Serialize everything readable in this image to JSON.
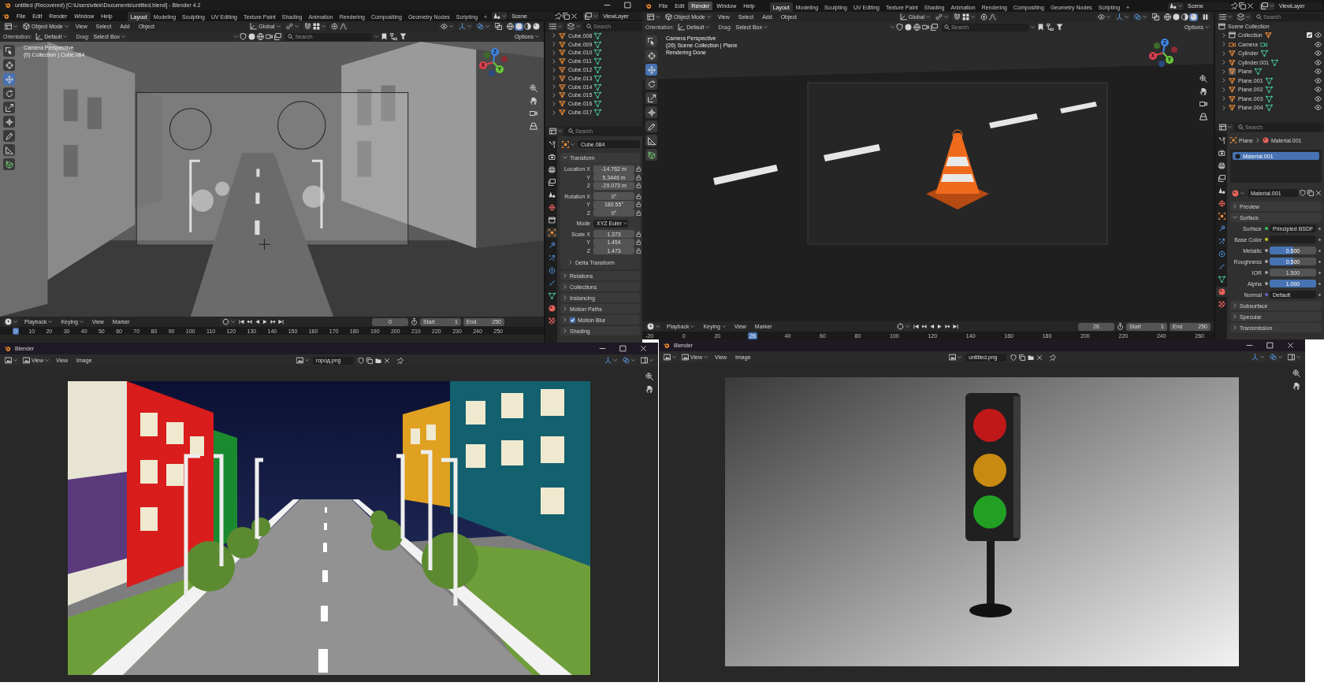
{
  "top_windows": [
    {
      "title": "untitled (Recovered) [C:\\Users\\vitek\\Documents\\untitled.blend] - Blender 4.2",
      "menu": [
        {
          "label": "File",
          "selected": false
        },
        {
          "label": "Edit",
          "selected": false
        },
        {
          "label": "Render",
          "selected": false
        },
        {
          "label": "Window",
          "selected": false
        },
        {
          "label": "Help",
          "selected": false
        }
      ],
      "workspaces": [
        {
          "label": "Layout",
          "selected": true
        },
        {
          "label": "Modeling",
          "selected": false
        },
        {
          "label": "Sculpting",
          "selected": false
        },
        {
          "label": "UV Editing",
          "selected": false
        },
        {
          "label": "Texture Paint",
          "selected": false
        },
        {
          "label": "Shading",
          "selected": false
        },
        {
          "label": "Animation",
          "selected": false
        },
        {
          "label": "Rendering",
          "selected": false
        },
        {
          "label": "Compositing",
          "selected": false
        },
        {
          "label": "Geometry Nodes",
          "selected": false
        },
        {
          "label": "Scripting",
          "selected": false
        }
      ],
      "add_workspace": "+",
      "scene": "Scene",
      "view_layer": "ViewLayer",
      "header": {
        "mode": "Object Mode",
        "menus": [
          "View",
          "Select",
          "Add",
          "Object"
        ],
        "transform": "Global",
        "proportional_editing": false,
        "orientation_label": "Orientation:",
        "orientation": "Default",
        "drag_label": "Drag:",
        "drag": "Select Box",
        "search_placeholder": "Search",
        "options": "Options",
        "shading": [
          {
            "kind": "wireframe",
            "selected": false
          },
          {
            "kind": "solid",
            "selected": true
          },
          {
            "kind": "material",
            "selected": false
          },
          {
            "kind": "rendered",
            "selected": false
          }
        ]
      },
      "viewport": {
        "kind": "street",
        "info": [
          "Camera Perspective",
          "(0) Collection | Cube.084"
        ],
        "axes": [
          "X",
          "Y",
          "Z"
        ],
        "tools": [
          {
            "kind": "select",
            "selected": false
          },
          {
            "kind": "cursor",
            "selected": false
          },
          {
            "kind": "move",
            "selected": true
          },
          {
            "kind": "rotate",
            "selected": false
          },
          {
            "kind": "scale",
            "selected": false
          },
          {
            "kind": "transform",
            "selected": false
          },
          {
            "kind": "annotate",
            "selected": false
          },
          {
            "kind": "measure",
            "selected": false
          },
          {
            "kind": "add_cube",
            "selected": false
          }
        ]
      },
      "outliner": {
        "search_placeholder": "Search",
        "items": [
          {
            "name": "Cube.008",
            "kind": "mesh",
            "selected": false
          },
          {
            "name": "Cube.009",
            "kind": "mesh",
            "selected": false
          },
          {
            "name": "Cube.010",
            "kind": "mesh",
            "selected": false
          },
          {
            "name": "Cube.011",
            "kind": "mesh",
            "selected": false
          },
          {
            "name": "Cube.012",
            "kind": "mesh",
            "selected": false
          },
          {
            "name": "Cube.013",
            "kind": "mesh",
            "selected": false
          },
          {
            "name": "Cube.014",
            "kind": "mesh",
            "selected": false
          },
          {
            "name": "Cube.015",
            "kind": "mesh",
            "selected": false
          },
          {
            "name": "Cube.016",
            "kind": "mesh",
            "selected": false
          },
          {
            "name": "Cube.017",
            "kind": "mesh",
            "selected": false
          }
        ]
      },
      "properties": {
        "kind": "object",
        "search_placeholder": "Search",
        "tabs": [
          {
            "kind": "tool",
            "selected": false
          },
          {
            "kind": "render",
            "selected": false
          },
          {
            "kind": "output",
            "selected": false
          },
          {
            "kind": "view_layer",
            "selected": false
          },
          {
            "kind": "scene",
            "selected": false
          },
          {
            "kind": "world",
            "selected": false
          },
          {
            "kind": "collection",
            "selected": false
          },
          {
            "kind": "object",
            "selected": true
          },
          {
            "kind": "modifiers",
            "selected": false
          },
          {
            "kind": "particles",
            "selected": false
          },
          {
            "kind": "physics",
            "selected": false
          },
          {
            "kind": "constraints",
            "selected": false
          },
          {
            "kind": "data",
            "selected": false
          },
          {
            "kind": "material",
            "selected": false
          },
          {
            "kind": "texture",
            "selected": false
          }
        ],
        "object": "Cube.084",
        "transform": {
          "label": "Transform",
          "expanded": true,
          "groups": [
            [
              {
                "label": "Location X",
                "value": "-14.762 m",
                "kind": "number"
              },
              {
                "label": "Y",
                "value": "5.3446 m",
                "kind": "number"
              },
              {
                "label": "Z",
                "value": "-29.073 m",
                "kind": "number"
              }
            ],
            [
              {
                "label": "Rotation X",
                "value": "0°",
                "kind": "number"
              },
              {
                "label": "Y",
                "value": "180.55°",
                "kind": "number"
              },
              {
                "label": "Z",
                "value": "0°",
                "kind": "number"
              }
            ],
            [
              {
                "label": "Mode",
                "value": "XYZ Euler",
                "kind": "dropdown"
              }
            ],
            [
              {
                "label": "Scale X",
                "value": "1.373",
                "kind": "number"
              },
              {
                "label": "Y",
                "value": "1.454",
                "kind": "number"
              },
              {
                "label": "Z",
                "value": "1.473",
                "kind": "number"
              }
            ]
          ],
          "sub_panels": [
            {
              "label": "Delta Transform",
              "expanded": false
            }
          ]
        },
        "panels": [
          {
            "label": "Relations",
            "kind": "plain",
            "expanded": false
          },
          {
            "label": "Collections",
            "kind": "plain",
            "expanded": false
          },
          {
            "label": "Instancing",
            "kind": "plain",
            "expanded": false
          },
          {
            "label": "Motion Paths",
            "kind": "plain",
            "expanded": false
          },
          {
            "label": "Motion Blur",
            "kind": "checkbox",
            "checked": true,
            "expanded": false
          },
          {
            "label": "Shading",
            "kind": "plain",
            "expanded": false
          }
        ]
      },
      "timeline": {
        "menus": [
          "Playback",
          "Keying",
          "View",
          "Marker"
        ],
        "auto_keying": false,
        "frame": "0",
        "start_label": "Start",
        "start": "1",
        "end_label": "End",
        "end": "250",
        "ruler": [
          {
            "label": "0",
            "selected": true
          },
          {
            "label": "10",
            "selected": false
          },
          {
            "label": "20",
            "selected": false
          },
          {
            "label": "30",
            "selected": false
          },
          {
            "label": "40",
            "selected": false
          },
          {
            "label": "50",
            "selected": false
          },
          {
            "label": "60",
            "selected": false
          },
          {
            "label": "70",
            "selected": false
          },
          {
            "label": "80",
            "selected": false
          },
          {
            "label": "90",
            "selected": false
          },
          {
            "label": "100",
            "selected": false
          },
          {
            "label": "110",
            "selected": false
          },
          {
            "label": "120",
            "selected": false
          },
          {
            "label": "130",
            "selected": false
          },
          {
            "label": "140",
            "selected": false
          },
          {
            "label": "150",
            "selected": false
          },
          {
            "label": "160",
            "selected": false
          },
          {
            "label": "170",
            "selected": false
          },
          {
            "label": "180",
            "selected": false
          },
          {
            "label": "190",
            "selected": false
          },
          {
            "label": "200",
            "selected": false
          },
          {
            "label": "210",
            "selected": false
          },
          {
            "label": "220",
            "selected": false
          },
          {
            "label": "230",
            "selected": false
          },
          {
            "label": "240",
            "selected": false
          },
          {
            "label": "250",
            "selected": false
          }
        ]
      }
    },
    {
      "menu": [
        {
          "label": "File",
          "selected": false
        },
        {
          "label": "Edit",
          "selected": false
        },
        {
          "label": "Render",
          "selected": true
        },
        {
          "label": "Window",
          "selected": false
        },
        {
          "label": "Help",
          "selected": false
        }
      ],
      "workspaces": [
        {
          "label": "Layout",
          "selected": true
        },
        {
          "label": "Modeling",
          "selected": false
        },
        {
          "label": "Sculpting",
          "selected": false
        },
        {
          "label": "UV Editing",
          "selected": false
        },
        {
          "label": "Texture Paint",
          "selected": false
        },
        {
          "label": "Shading",
          "selected": false
        },
        {
          "label": "Animation",
          "selected": false
        },
        {
          "label": "Rendering",
          "selected": false
        },
        {
          "label": "Compositing",
          "selected": false
        },
        {
          "label": "Geometry Nodes",
          "selected": false
        },
        {
          "label": "Scripting",
          "selected": false
        }
      ],
      "add_workspace": "+",
      "scene": "Scene",
      "view_layer": "ViewLayer",
      "header": {
        "mode": "Object Mode",
        "menus": [
          "View",
          "Select",
          "Add",
          "Object"
        ],
        "transform": "Global",
        "proportional_editing": false,
        "orientation_label": "Orientation:",
        "orientation": "Default",
        "drag_label": "Drag:",
        "drag": "Select Box",
        "search_placeholder": "Search",
        "options": "Options",
        "shading": [
          {
            "kind": "wireframe",
            "selected": false
          },
          {
            "kind": "solid",
            "selected": false
          },
          {
            "kind": "material",
            "selected": false
          },
          {
            "kind": "rendered",
            "selected": true
          }
        ]
      },
      "viewport": {
        "kind": "cone",
        "info": [
          "Camera Perspective",
          "(26) Scene Collection | Plane",
          "Rendering Done"
        ],
        "axes": [
          "X",
          "Y",
          "Z"
        ],
        "tools": [
          {
            "kind": "select",
            "selected": false
          },
          {
            "kind": "cursor",
            "selected": false
          },
          {
            "kind": "move",
            "selected": true
          },
          {
            "kind": "rotate",
            "selected": false
          },
          {
            "kind": "scale",
            "selected": false
          },
          {
            "kind": "transform",
            "selected": false
          },
          {
            "kind": "annotate",
            "selected": false
          },
          {
            "kind": "measure",
            "selected": false
          },
          {
            "kind": "add_cube",
            "selected": false
          }
        ]
      },
      "outliner": {
        "search_placeholder": "Search",
        "root": "Scene Collection",
        "items": [
          {
            "name": "Collection",
            "kind": "collection",
            "selected": false,
            "checked": true,
            "visible": true
          },
          {
            "name": "Camera",
            "kind": "camera",
            "selected": false,
            "visible": true
          },
          {
            "name": "Cylinder",
            "kind": "mesh",
            "selected": false,
            "visible": true
          },
          {
            "name": "Cylinder.001",
            "kind": "mesh",
            "selected": false,
            "visible": true
          },
          {
            "name": "Plane",
            "kind": "mesh",
            "selected": true,
            "visible": true
          },
          {
            "name": "Plane.001",
            "kind": "mesh",
            "selected": false,
            "visible": true
          },
          {
            "name": "Plane.002",
            "kind": "mesh",
            "selected": false,
            "visible": true
          },
          {
            "name": "Plane.003",
            "kind": "mesh",
            "selected": false,
            "visible": true
          },
          {
            "name": "Plane.004",
            "kind": "mesh",
            "selected": false,
            "visible": true
          }
        ]
      },
      "properties": {
        "kind": "material",
        "search_placeholder": "Search",
        "tabs": [
          {
            "kind": "tool",
            "selected": false
          },
          {
            "kind": "render",
            "selected": false
          },
          {
            "kind": "output",
            "selected": false
          },
          {
            "kind": "view_layer",
            "selected": false
          },
          {
            "kind": "scene",
            "selected": false
          },
          {
            "kind": "world",
            "selected": false
          },
          {
            "kind": "object",
            "selected": false
          },
          {
            "kind": "modifiers",
            "selected": false
          },
          {
            "kind": "particles",
            "selected": false
          },
          {
            "kind": "physics",
            "selected": false
          },
          {
            "kind": "constraints",
            "selected": false
          },
          {
            "kind": "data",
            "selected": false
          },
          {
            "kind": "material",
            "selected": true
          },
          {
            "kind": "texture",
            "selected": false
          }
        ],
        "object": "Plane",
        "material": "Material.001",
        "slots": [
          {
            "name": "Material.001",
            "selected": true
          }
        ],
        "material_field": "Material.001",
        "panels": [
          {
            "label": "Preview",
            "expanded": false
          },
          {
            "label": "Surface",
            "expanded": true,
            "rows": [
              {
                "label": "Surface",
                "kind": "link",
                "value": "Principled BSDF",
                "color": "#3fbf5a"
              },
              {
                "label": "Base Color",
                "kind": "color",
                "color": "#c7c729"
              },
              {
                "label": "Metallic",
                "kind": "slider",
                "value": "0.500",
                "level": 0.5,
                "color": "#a1a1a1"
              },
              {
                "label": "Roughness",
                "kind": "slider",
                "value": "0.500",
                "level": 0.5,
                "color": "#a1a1a1"
              },
              {
                "label": "IOR",
                "kind": "number",
                "value": "1.500",
                "color": "#a1a1a1"
              },
              {
                "label": "Alpha",
                "kind": "slider",
                "value": "1.000",
                "level": 1,
                "color": "#a1a1a1"
              },
              {
                "label": "Normal",
                "kind": "link",
                "value": "Default",
                "color": "#6363c7"
              }
            ]
          },
          {
            "label": "Subsurface",
            "expanded": false
          },
          {
            "label": "Specular",
            "expanded": false
          },
          {
            "label": "Transmission",
            "expanded": false
          }
        ]
      },
      "timeline": {
        "menus": [
          "Playback",
          "Keying",
          "View",
          "Marker"
        ],
        "auto_keying": false,
        "frame": "26",
        "start_label": "Start",
        "start": "1",
        "end_label": "End",
        "end": "250",
        "ruler": [
          {
            "label": "-20",
            "selected": false
          },
          {
            "label": "0",
            "selected": false
          },
          {
            "label": "20",
            "selected": false
          },
          {
            "label": "26",
            "selected": true
          },
          {
            "label": "40",
            "selected": false
          },
          {
            "label": "60",
            "selected": false
          },
          {
            "label": "80",
            "selected": false
          },
          {
            "label": "100",
            "selected": false
          },
          {
            "label": "120",
            "selected": false
          },
          {
            "label": "140",
            "selected": false
          },
          {
            "label": "160",
            "selected": false
          },
          {
            "label": "180",
            "selected": false
          },
          {
            "label": "200",
            "selected": false
          },
          {
            "label": "220",
            "selected": false
          },
          {
            "label": "240",
            "selected": false
          },
          {
            "label": "260",
            "selected": false
          }
        ]
      }
    }
  ],
  "image_windows": [
    {
      "title": "Blender",
      "view_mode": "View",
      "menus": [
        "View",
        "Image"
      ],
      "image_name": "город.png",
      "kind": "city"
    },
    {
      "title": "Blender",
      "view_mode": "View",
      "menus": [
        "View",
        "Image"
      ],
      "image_name": "untitled.png",
      "kind": "traffic_light"
    }
  ]
}
